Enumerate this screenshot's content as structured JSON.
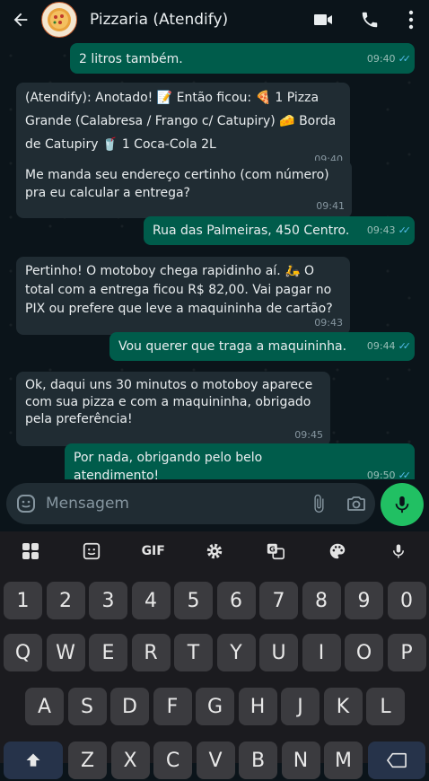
{
  "header": {
    "title": "Pizzaria (Atendify)"
  },
  "messages": [
    {
      "dir": "out",
      "text": "2 litros também.",
      "time": "09:40",
      "read": true
    },
    {
      "dir": "in",
      "text": "(Atendify): Anotado! 📝 Então ficou: 🍕 1 Pizza Grande (Calabresa / Frango c/ Catupiry) 🧀 Borda de Catupiry 🥤 1 Coca-Cola 2L",
      "time": "09:40"
    },
    {
      "dir": "in",
      "text": "Me manda seu endereço certinho (com número) pra eu calcular a entrega?",
      "time": "09:41"
    },
    {
      "dir": "out",
      "text": "Rua das Palmeiras, 450 Centro.",
      "time": "09:43",
      "read": true
    },
    {
      "dir": "in",
      "text": "Pertinho! O motoboy chega rapidinho aí. 🛵 O total com a entrega ficou R$ 82,00. Vai pagar no PIX ou prefere que leve a maquininha de cartão?",
      "time": "09:43"
    },
    {
      "dir": "out",
      "text": "Vou querer que traga a maquininha.",
      "time": "09:44",
      "read": true
    },
    {
      "dir": "in",
      "text": "Ok, daqui uns 30 minutos o motoboy aparece com sua pizza e com a maquininha, obrigado pela preferência!",
      "time": "09:45"
    },
    {
      "dir": "out",
      "text": "Por nada, obrigando pelo belo atendimento!",
      "time": "09:50",
      "read": true
    }
  ],
  "input": {
    "placeholder": "Mensagem"
  },
  "keyboard": {
    "toolbar": [
      "apps-icon",
      "sticker-icon",
      "GIF",
      "settings-icon",
      "translate-icon",
      "palette-icon",
      "mic-icon"
    ],
    "gif_label": "GIF",
    "row_numbers": [
      "1",
      "2",
      "3",
      "4",
      "5",
      "6",
      "7",
      "8",
      "9",
      "0"
    ],
    "row_qwerty": [
      "Q",
      "W",
      "E",
      "R",
      "T",
      "Y",
      "U",
      "I",
      "O",
      "P"
    ],
    "row_asdf": [
      "A",
      "S",
      "D",
      "F",
      "G",
      "H",
      "J",
      "K",
      "L"
    ],
    "row_zxcv": [
      "Z",
      "X",
      "C",
      "V",
      "B",
      "N",
      "M"
    ]
  },
  "colors": {
    "incoming_bubble": "#202c33",
    "outgoing_bubble": "#005c4b",
    "accent_green": "#21c063",
    "read_ticks": "#53bdeb"
  }
}
